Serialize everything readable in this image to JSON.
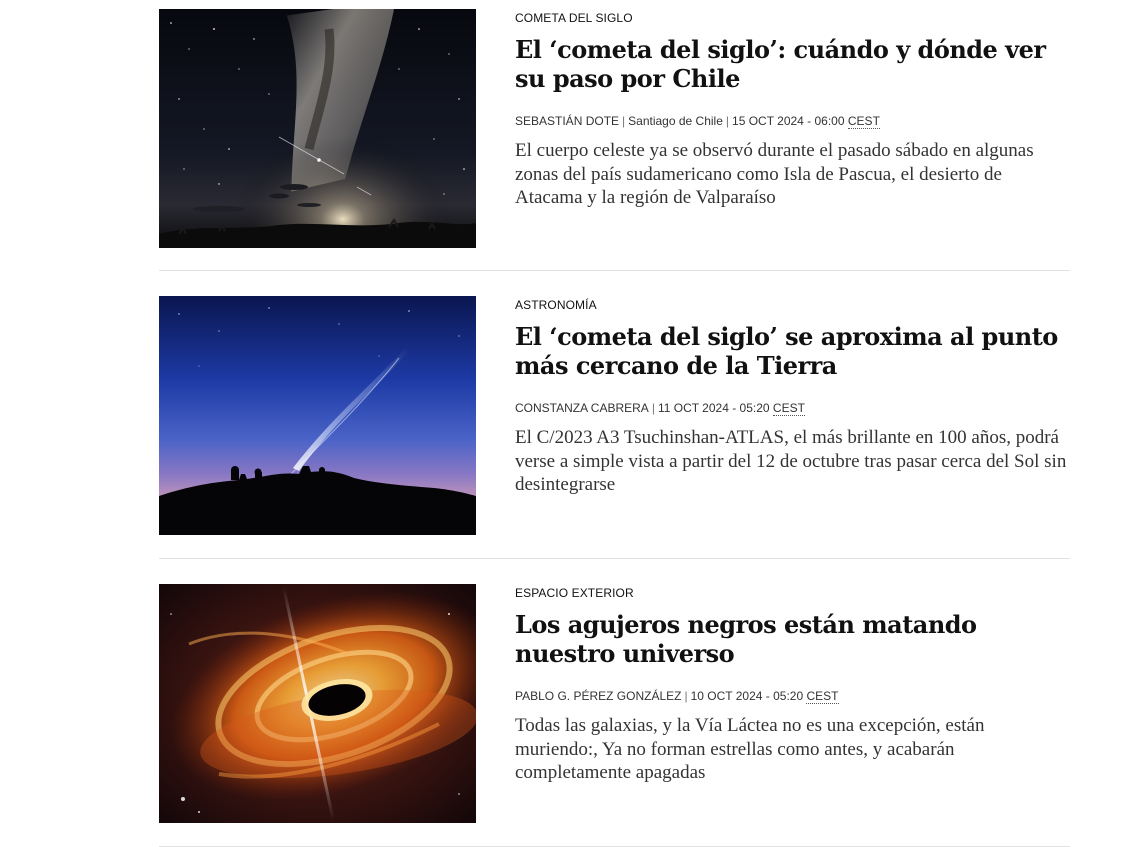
{
  "articles": [
    {
      "section": "COMETA DEL SIGLO",
      "headline": "El ‘cometa del siglo’: cuándo y dónde ver su paso por Chile",
      "author": "SEBASTIÁN DOTE",
      "location": "Santiago de Chile",
      "date": "15 OCT 2024 - 06:00",
      "timezone": "CEST",
      "summary": "El cuerpo celeste ya se observó durante el pasado sábado en algunas zonas del país sudamericano como Isla de Pascua, el desierto de Atacama y la región de Valparaíso",
      "image": "milky-way-night-sky-photo"
    },
    {
      "section": "ASTRONOMÍA",
      "headline": "El ‘cometa del siglo’ se aproxima al punto más cercano de la Tierra",
      "author": "CONSTANZA CABRERA",
      "date": "11 OCT 2024 - 05:20",
      "timezone": "CEST",
      "summary": "El C/2023 A3 Tsuchinshan-ATLAS, el más brillante en 100 años, podrá verse a simple vista a partir del 12 de octubre tras pasar cerca del Sol sin desintegrarse",
      "image": "comet-over-observatory-twilight-photo"
    },
    {
      "section": "ESPACIO EXTERIOR",
      "headline": "Los agujeros negros están matando nuestro universo",
      "author": "PABLO G. PÉREZ GONZÁLEZ",
      "date": "10 OCT 2024 - 05:20",
      "timezone": "CEST",
      "summary": "Todas las galaxias, y la Vía Láctea no es una excepción, están muriendo:, Ya no forman estrellas como antes, y acabarán completamente apagadas",
      "image": "black-hole-accretion-disk-illustration"
    }
  ]
}
